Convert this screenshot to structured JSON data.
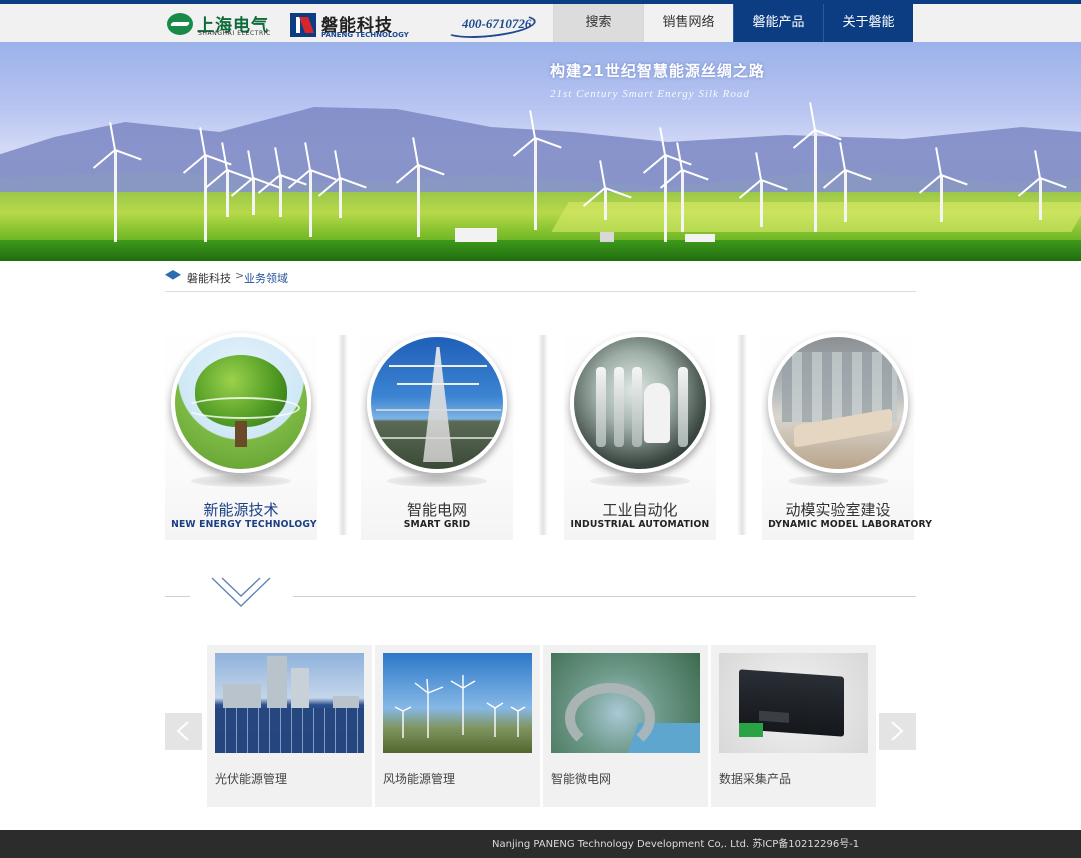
{
  "header": {
    "logo1": {
      "cn": "上海电气",
      "en": "SHANGHAI ELECTRIC"
    },
    "logo2": {
      "cn": "磐能科技",
      "en": "PANENG TECHNOLOGY"
    },
    "hotline": "400-6710726",
    "nav": [
      {
        "label": "搜索"
      },
      {
        "label": "销售网络"
      },
      {
        "label": "磐能产品"
      },
      {
        "label": "关于磐能"
      }
    ],
    "colors": {
      "brand": "#0c3d83",
      "top_line": "#0c3d83"
    }
  },
  "banner": {
    "title_cn": "构建21世纪智慧能源丝绸之路",
    "title_en": "21st Century Smart Energy Silk Road"
  },
  "breadcrumb": {
    "home": "磐能科技",
    "separator": ">",
    "current": "业务领域"
  },
  "areas": [
    {
      "cn": "新能源技术",
      "en": "NEW ENERGY TECHNOLOGY",
      "image": "tree-globe"
    },
    {
      "cn": "智能电网",
      "en": "SMART GRID",
      "image": "power-tower"
    },
    {
      "cn": "工业自动化",
      "en": "INDUSTRIAL AUTOMATION",
      "image": "industrial-plant"
    },
    {
      "cn": "动模实验室建设",
      "en": "DYNAMIC MODEL LABORATORY",
      "image": "control-room"
    }
  ],
  "carousel": {
    "items": [
      {
        "caption": "光伏能源管理",
        "image": "solar-panels"
      },
      {
        "caption": "风场能源管理",
        "image": "wind-farm"
      },
      {
        "caption": "智能微电网",
        "image": "micro-grid-park"
      },
      {
        "caption": "数据采集产品",
        "image": "data-collector-box"
      }
    ],
    "prev_icon": "chevron-left-icon",
    "next_icon": "chevron-right-icon"
  },
  "footer": {
    "text": "Nanjing PANENG Technology Development Co,. Ltd. 苏ICP备10212296号-1"
  }
}
